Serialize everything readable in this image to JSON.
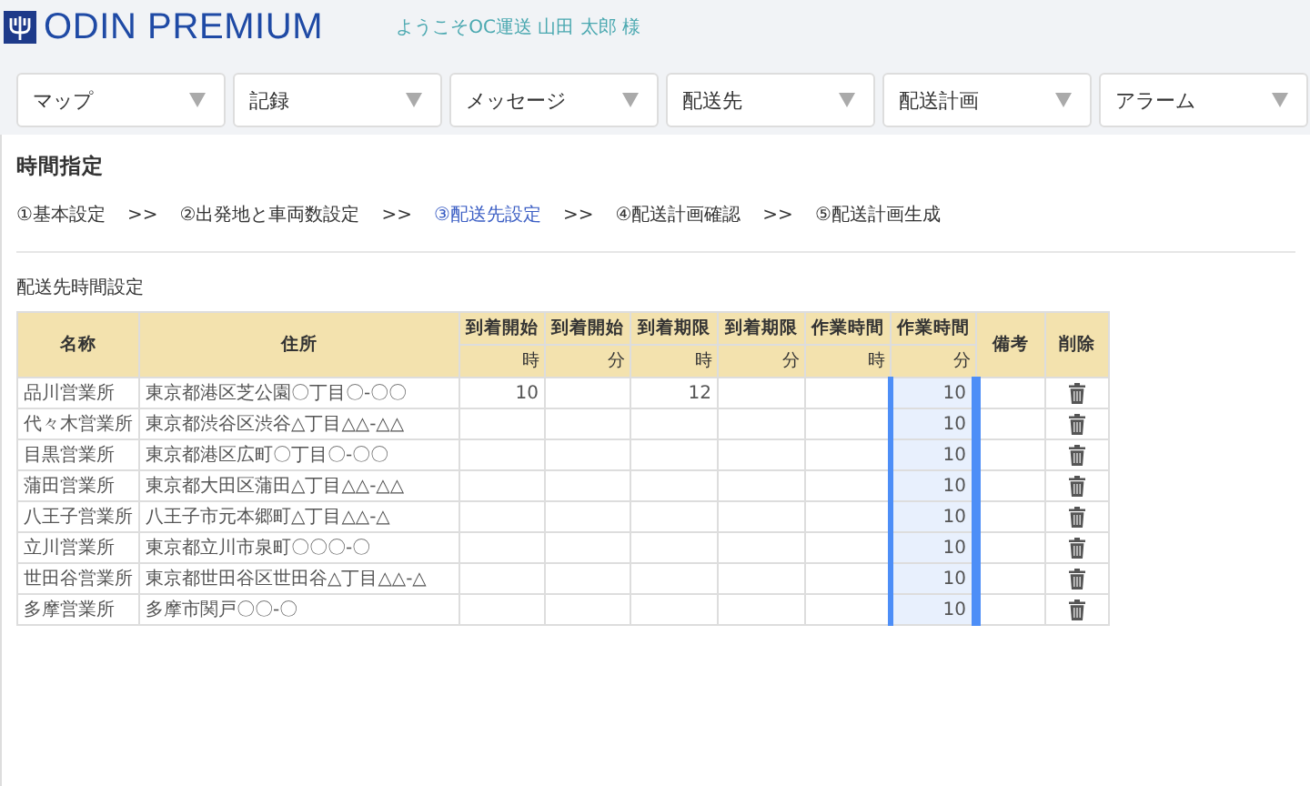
{
  "header": {
    "logo": "ODIN PREMIUM",
    "welcome": "ようこそOC運送 山田 太郎 様"
  },
  "menu": [
    {
      "label": "マップ"
    },
    {
      "label": "記録"
    },
    {
      "label": "メッセージ"
    },
    {
      "label": "配送先"
    },
    {
      "label": "配送計画"
    },
    {
      "label": "アラーム"
    }
  ],
  "page_title": "時間指定",
  "steps": [
    {
      "label": "①基本設定",
      "selected": false
    },
    {
      "label": "②出発地と車両数設定",
      "selected": false
    },
    {
      "label": "③配送先設定",
      "selected": true
    },
    {
      "label": "④配送計画確認",
      "selected": false
    },
    {
      "label": "⑤配送計画生成",
      "selected": false
    }
  ],
  "step_separator": ">>",
  "section_title": "配送先時間設定",
  "table": {
    "columns": [
      {
        "label": "名称",
        "kind": "text",
        "selected": false
      },
      {
        "label": "住所",
        "kind": "text",
        "selected": false
      },
      {
        "label": "到着開始",
        "unit": "時",
        "kind": "num",
        "selected": false
      },
      {
        "label": "到着開始",
        "unit": "分",
        "kind": "num",
        "selected": false
      },
      {
        "label": "到着期限",
        "unit": "時",
        "kind": "num",
        "selected": false
      },
      {
        "label": "到着期限",
        "unit": "分",
        "kind": "num",
        "selected": false
      },
      {
        "label": "作業時間",
        "unit": "時",
        "kind": "num",
        "selected": false
      },
      {
        "label": "作業時間",
        "unit": "分",
        "kind": "num",
        "selected": true
      },
      {
        "label": "備考",
        "kind": "text",
        "selected": false
      },
      {
        "label": "削除",
        "kind": "delete",
        "selected": false
      }
    ],
    "rows": [
      [
        "品川営業所",
        "東京都港区芝公園〇丁目〇-〇〇",
        "10",
        "",
        "12",
        "",
        "",
        "10",
        "",
        ""
      ],
      [
        "代々木営業所",
        "東京都渋谷区渋谷△丁目△△-△△",
        "",
        "",
        "",
        "",
        "",
        "10",
        "",
        ""
      ],
      [
        "目黒営業所",
        "東京都港区広町〇丁目〇-〇〇",
        "",
        "",
        "",
        "",
        "",
        "10",
        "",
        ""
      ],
      [
        "蒲田営業所",
        "東京都大田区蒲田△丁目△△-△△",
        "",
        "",
        "",
        "",
        "",
        "10",
        "",
        ""
      ],
      [
        "八王子営業所",
        "八王子市元本郷町△丁目△△-△",
        "",
        "",
        "",
        "",
        "",
        "10",
        "",
        ""
      ],
      [
        "立川営業所",
        "東京都立川市泉町〇〇〇-〇",
        "",
        "",
        "",
        "",
        "",
        "10",
        "",
        ""
      ],
      [
        "世田谷営業所",
        "東京都世田谷区世田谷△丁目△△-△",
        "",
        "",
        "",
        "",
        "",
        "10",
        "",
        ""
      ],
      [
        "多摩営業所",
        "多摩市関戸〇〇-〇",
        "",
        "",
        "",
        "",
        "",
        "10",
        "",
        ""
      ]
    ]
  }
}
